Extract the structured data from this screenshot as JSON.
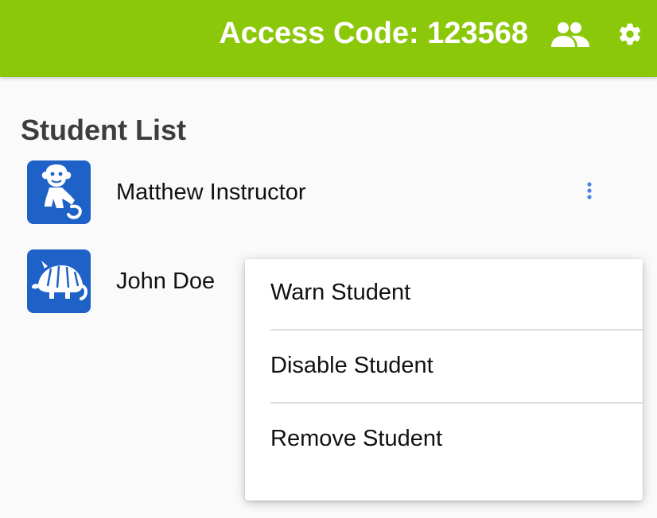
{
  "header": {
    "access_code_text": "Access Code: 123568",
    "people_icon": "people-icon",
    "settings_icon": "gear-icon",
    "bg_color": "#8cc80a"
  },
  "main": {
    "title": "Student List",
    "students": [
      {
        "name": "Matthew Instructor",
        "avatar_icon": "monkey-avatar-icon",
        "avatar_color": "#1f62c7"
      },
      {
        "name": "John Doe",
        "avatar_icon": "armadillo-avatar-icon",
        "avatar_color": "#1f62c7"
      }
    ],
    "kebab_icon": "more-vert-icon"
  },
  "context_menu": {
    "items": [
      {
        "label": "Warn Student"
      },
      {
        "label": "Disable Student"
      },
      {
        "label": "Remove Student"
      }
    ]
  }
}
